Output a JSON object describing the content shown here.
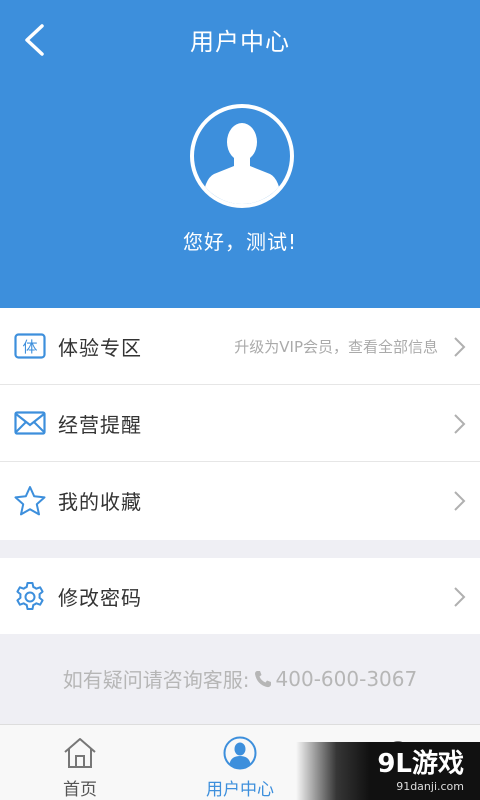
{
  "header": {
    "title": "用户中心",
    "back_icon": "back-arrow-icon",
    "greeting": "您好，测试!",
    "avatar_icon": "default-avatar-icon",
    "bg_color": "#3d8fdc"
  },
  "menu": {
    "group1": [
      {
        "icon": "trial-badge-icon",
        "label": "体验专区",
        "hint": "升级为VIP会员，查看全部信息",
        "badge_char": "体"
      },
      {
        "icon": "mail-icon",
        "label": "经营提醒",
        "hint": ""
      },
      {
        "icon": "star-icon",
        "label": "我的收藏",
        "hint": ""
      }
    ],
    "group2": [
      {
        "icon": "gear-icon",
        "label": "修改密码",
        "hint": ""
      }
    ]
  },
  "hotline": {
    "prefix": "如有疑问请咨询客服:",
    "phone_icon": "phone-icon",
    "number": "400-600-3067"
  },
  "tabbar": {
    "tabs": [
      {
        "icon": "home-icon",
        "label": "首页",
        "active": false
      },
      {
        "icon": "user-center-icon",
        "label": "用户中心",
        "active": true
      },
      {
        "icon": "search-icon",
        "label": "",
        "active": false
      }
    ]
  },
  "watermark": {
    "main": "9L游戏",
    "sub": "91danji.com"
  }
}
